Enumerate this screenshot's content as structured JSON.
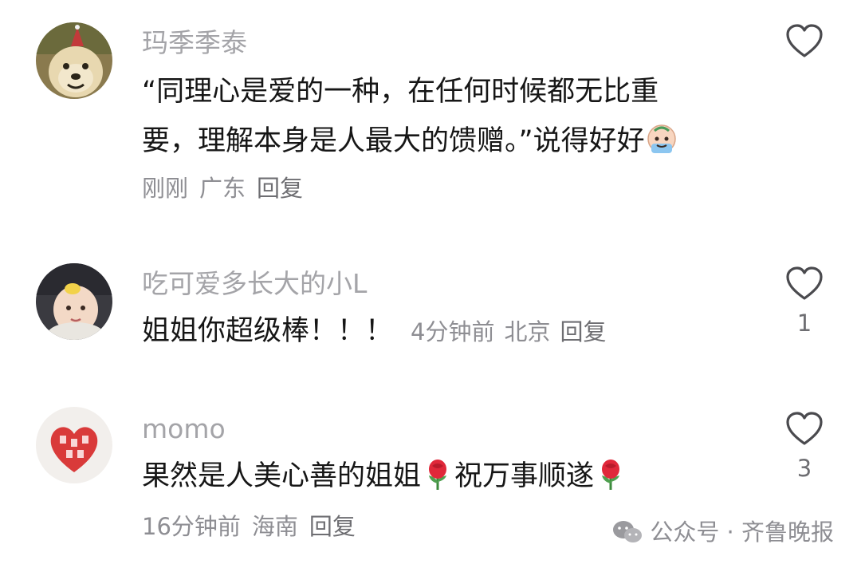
{
  "comments": [
    {
      "username": "玛季季泰",
      "text_line1": "“同理心是爱的一种，在任何时候都无比重",
      "text_line2": "要，理解本身是人最大的馈赠。”说得好好",
      "time": "刚刚",
      "location": "广东",
      "reply": "回复",
      "likes": "",
      "emoji": "crying-face-emoji"
    },
    {
      "username": "吃可爱多长大的小L",
      "text": "姐姐你超级棒！！！",
      "time": "4分钟前",
      "location": "北京",
      "reply": "回复",
      "likes": "1"
    },
    {
      "username": "momo",
      "text_part1": "果然是人美心善的姐姐",
      "text_part2": "祝万事顺遂",
      "time": "16分钟前",
      "location": "海南",
      "reply": "回复",
      "likes": "3",
      "emoji": "rose-emoji"
    }
  ],
  "watermark": {
    "text": "公众号 · 齐鲁晚报",
    "icon": "wechat-icon"
  },
  "colors": {
    "text": "#161616",
    "muted": "#8e8e93",
    "username": "#a4a4a8"
  }
}
